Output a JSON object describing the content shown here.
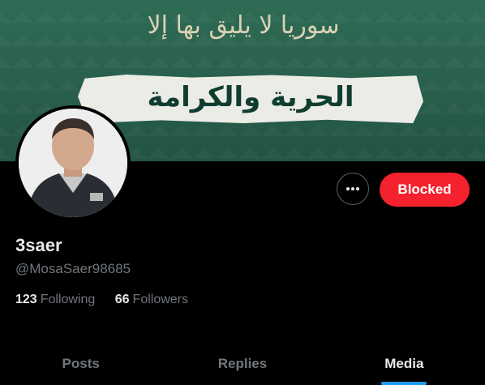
{
  "banner": {
    "line1": "سوريا لا يليق بها إلا",
    "line2": "الحرية والكرامة"
  },
  "profile": {
    "display_name": "3saer",
    "handle": "@MosaSaer98685",
    "following_count": "123",
    "following_label": "Following",
    "followers_count": "66",
    "followers_label": "Followers"
  },
  "actions": {
    "more_icon": "more-horizontal-icon",
    "blocked_label": "Blocked"
  },
  "tabs": [
    {
      "label": "Posts",
      "active": false
    },
    {
      "label": "Replies",
      "active": false
    },
    {
      "label": "Media",
      "active": true
    }
  ],
  "colors": {
    "blocked": "#f4212e",
    "accent": "#1d9bf0",
    "banner": "#2f6b55"
  }
}
